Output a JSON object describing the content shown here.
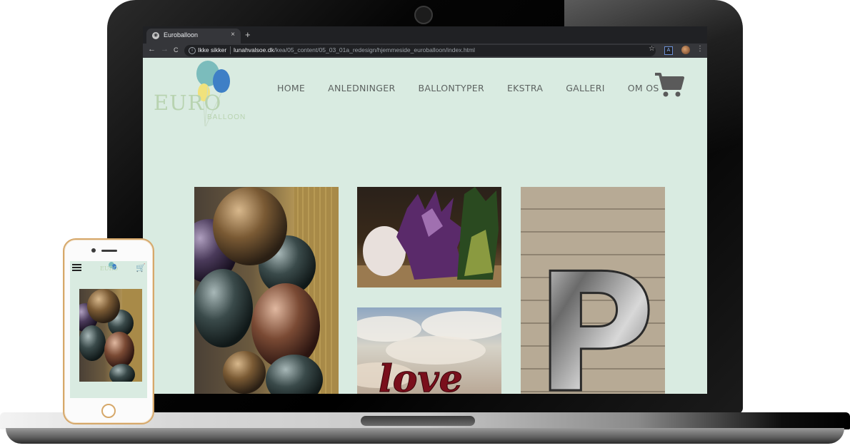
{
  "browser": {
    "tab_title": "Euroballoon",
    "tab_close": "×",
    "new_tab": "+",
    "back": "←",
    "forward": "→",
    "reload": "C",
    "security_label": "Ikke sikker",
    "url_domain": "lunahvalsoe.dk",
    "url_path": "/kea/05_content/05_03_01a_redesign/hjemmeside_euroballoon/index.html",
    "bookmark_star": "☆",
    "extension": "A",
    "menu": "⋮"
  },
  "site": {
    "logo_word": "EURO",
    "logo_sub": "BALLOON",
    "nav": [
      "HOME",
      "ANLEDNINGER",
      "BALLONTYPER",
      "EKSTRA",
      "GALLERI",
      "OM OS"
    ],
    "love_text": "love",
    "p_letter": "P"
  },
  "phone": {
    "logo": "EURO",
    "cart_icon": "🛒"
  },
  "colors": {
    "site_bg": "#d9ebe1",
    "nav_text": "#5d6361",
    "logo_text": "#b8d3b0",
    "phone_frame": "#d6a86a"
  }
}
